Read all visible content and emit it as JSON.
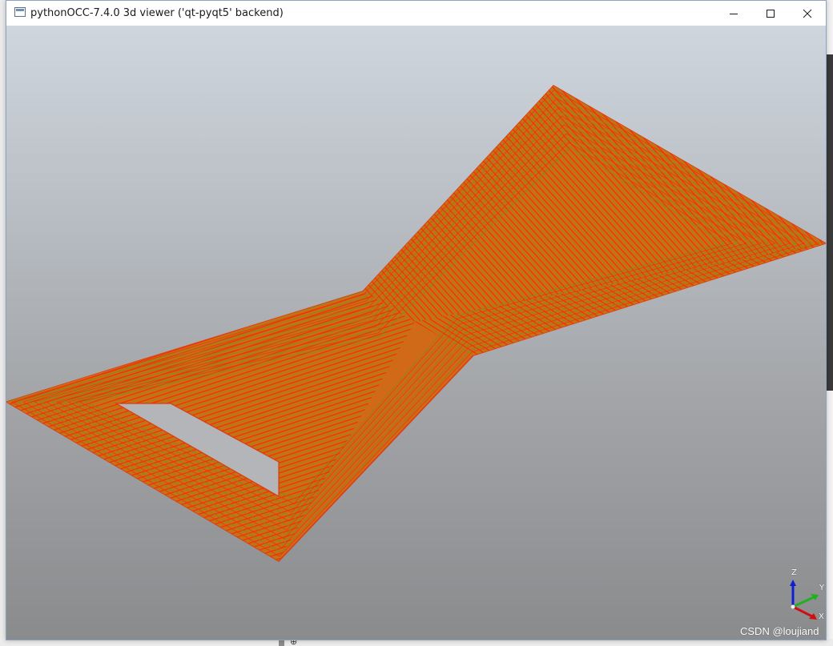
{
  "window": {
    "title": "pythonOCC-7.4.0 3d viewer ('qt-pyqt5' backend)",
    "icon": "app-window-icon",
    "controls": {
      "minimize_icon": "minimize-icon",
      "maximize_icon": "maximize-icon",
      "close_icon": "close-icon"
    }
  },
  "viewport": {
    "background_top": "#cfd6de",
    "background_bottom": "#8a8b8d",
    "shape": {
      "fill_color": "#d06a18",
      "toolpath_color_a": "#e03a0c",
      "toolpath_color_b": "#8a8a1a"
    },
    "triedron": {
      "z_label": "Z",
      "y_label": "Y",
      "x_label": "X",
      "z_color": "#1020d0",
      "y_color": "#20b020",
      "x_color": "#d01010"
    }
  },
  "watermark": "CSDN @loujiand"
}
